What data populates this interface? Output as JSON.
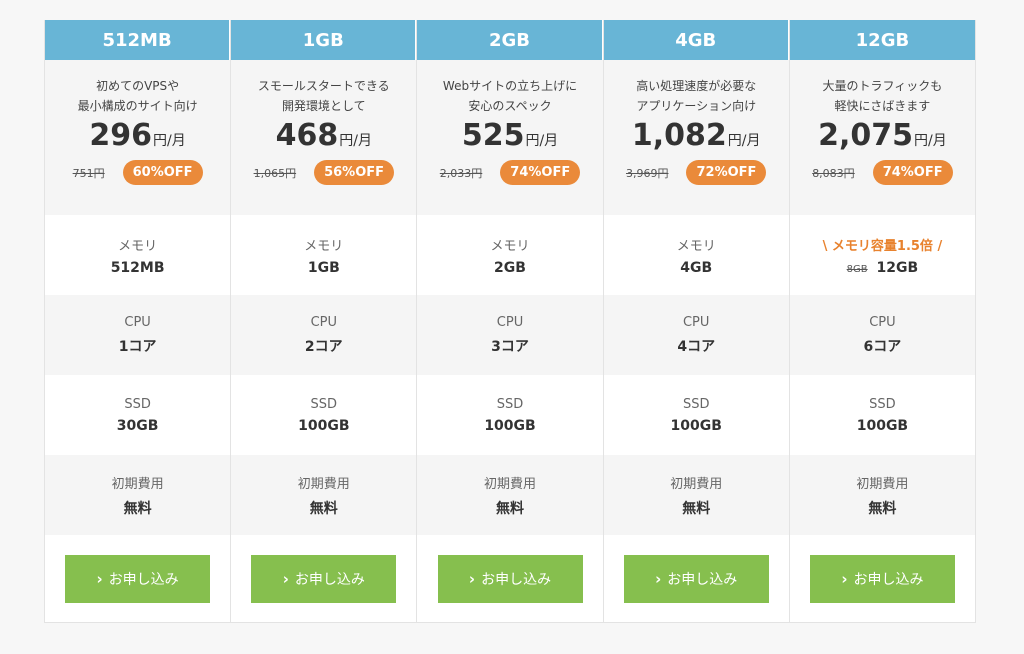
{
  "plans": [
    {
      "name": "512MB",
      "desc_line1": "初めてのVPSや",
      "desc_line2": "最小構成のサイト向け",
      "price": "296",
      "price_unit": "円/月",
      "old_price": "751円",
      "discount": "60%OFF",
      "memory_label": "メモリ",
      "memory_value": "512MB",
      "cpu_label": "CPU",
      "cpu_value": "1コア",
      "ssd_label": "SSD",
      "ssd_value": "30GB",
      "fee_label": "初期費用",
      "fee_value": "無料",
      "button_label": "お申し込み"
    },
    {
      "name": "1GB",
      "desc_line1": "スモールスタートできる",
      "desc_line2": "開発環境として",
      "price": "468",
      "price_unit": "円/月",
      "old_price": "1,065円",
      "discount": "56%OFF",
      "memory_label": "メモリ",
      "memory_value": "1GB",
      "cpu_label": "CPU",
      "cpu_value": "2コア",
      "ssd_label": "SSD",
      "ssd_value": "100GB",
      "fee_label": "初期費用",
      "fee_value": "無料",
      "button_label": "お申し込み"
    },
    {
      "name": "2GB",
      "desc_line1": "Webサイトの立ち上げに",
      "desc_line2": "安心のスペック",
      "price": "525",
      "price_unit": "円/月",
      "old_price": "2,033円",
      "discount": "74%OFF",
      "memory_label": "メモリ",
      "memory_value": "2GB",
      "cpu_label": "CPU",
      "cpu_value": "3コア",
      "ssd_label": "SSD",
      "ssd_value": "100GB",
      "fee_label": "初期費用",
      "fee_value": "無料",
      "button_label": "お申し込み"
    },
    {
      "name": "4GB",
      "desc_line1": "高い処理速度が必要な",
      "desc_line2": "アプリケーション向け",
      "price": "1,082",
      "price_unit": "円/月",
      "old_price": "3,969円",
      "discount": "72%OFF",
      "memory_label": "メモリ",
      "memory_value": "4GB",
      "cpu_label": "CPU",
      "cpu_value": "4コア",
      "ssd_label": "SSD",
      "ssd_value": "100GB",
      "fee_label": "初期費用",
      "fee_value": "無料",
      "button_label": "お申し込み"
    },
    {
      "name": "12GB",
      "desc_line1": "大量のトラフィックも",
      "desc_line2": "軽快にさばきます",
      "price": "2,075",
      "price_unit": "円/月",
      "old_price": "8,083円",
      "discount": "74%OFF",
      "memory_label": "\\ メモリ容量1.5倍 /",
      "memory_old": "8GB",
      "memory_value": "12GB",
      "cpu_label": "CPU",
      "cpu_value": "6コア",
      "ssd_label": "SSD",
      "ssd_value": "100GB",
      "fee_label": "初期費用",
      "fee_value": "無料",
      "button_label": "お申し込み"
    }
  ],
  "colors": {
    "header": "#68b5d6",
    "badge": "#ea8a3a",
    "button": "#86bf4e",
    "highlight": "#e8822e"
  },
  "icons": {
    "button_chevron": "chevron-right-icon"
  }
}
